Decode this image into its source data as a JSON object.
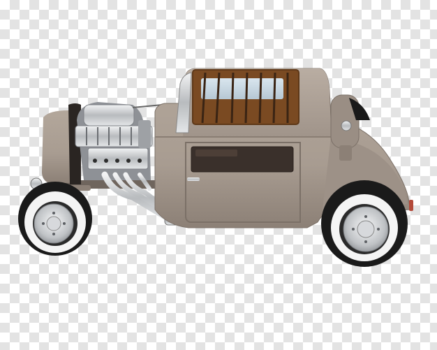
{
  "image": {
    "background": "transparency-checkerboard",
    "subject": "hot-rod-coupe",
    "colors": {
      "checker_light": "#ffffff",
      "checker_dark": "#e3e3e3",
      "body": "#a89c91",
      "body_shadow": "#8a7e74",
      "chrome": "#d8dadc",
      "tire": "#1a1a1a",
      "whitewall": "#f4f4f4",
      "interior": "#7a4a22"
    }
  }
}
